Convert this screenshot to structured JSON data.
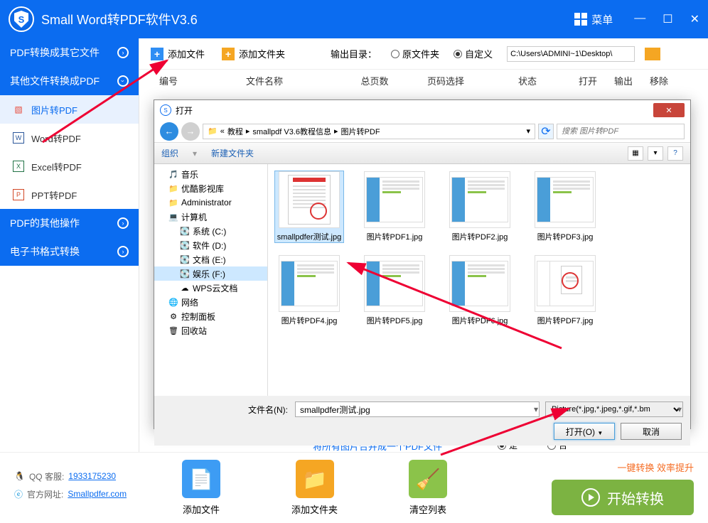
{
  "titlebar": {
    "app_title": "Small  Word转PDF软件V3.6",
    "menu_label": "菜单"
  },
  "sidebar": {
    "sections": [
      {
        "label": "PDF转换成其它文件"
      },
      {
        "label": "其他文件转换成PDF"
      },
      {
        "label": "PDF的其他操作"
      },
      {
        "label": "电子书格式转换"
      }
    ],
    "items": [
      {
        "label": "图片转PDF",
        "active": true
      },
      {
        "label": "Word转PDF"
      },
      {
        "label": "Excel转PDF"
      },
      {
        "label": "PPT转PDF"
      }
    ]
  },
  "toolbar": {
    "add_file": "添加文件",
    "add_folder": "添加文件夹",
    "output_label": "输出目录：",
    "opt_original": "原文件夹",
    "opt_custom": "自定义",
    "path": "C:\\Users\\ADMINI~1\\Desktop\\"
  },
  "columns": {
    "number": "编号",
    "filename": "文件名称",
    "pages": "总页数",
    "page_sel": "页码选择",
    "status": "状态",
    "open": "打开",
    "output": "输出",
    "remove": "移除"
  },
  "dialog": {
    "title": "打开",
    "toolbar_organize": "组织",
    "toolbar_new": "新建文件夹",
    "breadcrumb": [
      "教程",
      "smallpdf V3.6教程信息",
      "图片转PDF"
    ],
    "search_placeholder": "搜索 图片转PDF",
    "tree": [
      {
        "label": "音乐",
        "icon": "🎵"
      },
      {
        "label": "优酷影视库",
        "icon": "📁"
      },
      {
        "label": "Administrator",
        "icon": "📁"
      },
      {
        "label": "计算机",
        "icon": "💻"
      },
      {
        "label": "系统 (C:)",
        "icon": "💽",
        "l2": true
      },
      {
        "label": "软件 (D:)",
        "icon": "💽",
        "l2": true
      },
      {
        "label": "文档 (E:)",
        "icon": "💽",
        "l2": true
      },
      {
        "label": "娱乐 (F:)",
        "icon": "💽",
        "l2": true,
        "sel": true
      },
      {
        "label": "WPS云文档",
        "icon": "☁",
        "l2": true
      },
      {
        "label": "网络",
        "icon": "🌐"
      },
      {
        "label": "控制面板",
        "icon": "⚙"
      },
      {
        "label": "回收站",
        "icon": "🗑"
      }
    ],
    "files": [
      {
        "name": "smallpdfer测试.jpg",
        "sel": true,
        "type": "doc"
      },
      {
        "name": "图片转PDF1.jpg",
        "type": "app"
      },
      {
        "name": "图片转PDF2.jpg",
        "type": "app"
      },
      {
        "name": "图片转PDF3.jpg",
        "type": "app"
      },
      {
        "name": "图片转PDF4.jpg",
        "type": "app"
      },
      {
        "name": "图片转PDF5.jpg",
        "type": "app"
      },
      {
        "name": "图片转PDF6.jpg",
        "type": "app"
      },
      {
        "name": "图片转PDF7.jpg",
        "type": "doc2"
      }
    ],
    "filename_label": "文件名(N):",
    "filename_value": "smallpdfer测试.jpg",
    "filter": "Picture(*.jpg,*.jpeg,*.gif,*.bm",
    "open_btn": "打开(O)",
    "cancel_btn": "取消"
  },
  "hidden_merge_text": "将所有图片合并成一个PDF文件",
  "hidden_yes": "是",
  "hidden_no": "否",
  "footer": {
    "qq_label": "QQ 客服:",
    "qq_number": "1933175230",
    "site_label": "官方网址:",
    "site_url": "Smallpdfer.com",
    "add_file": "添加文件",
    "add_folder": "添加文件夹",
    "clear_list": "清空列表",
    "hint": "一键转换   效率提升",
    "start": "开始转换"
  }
}
